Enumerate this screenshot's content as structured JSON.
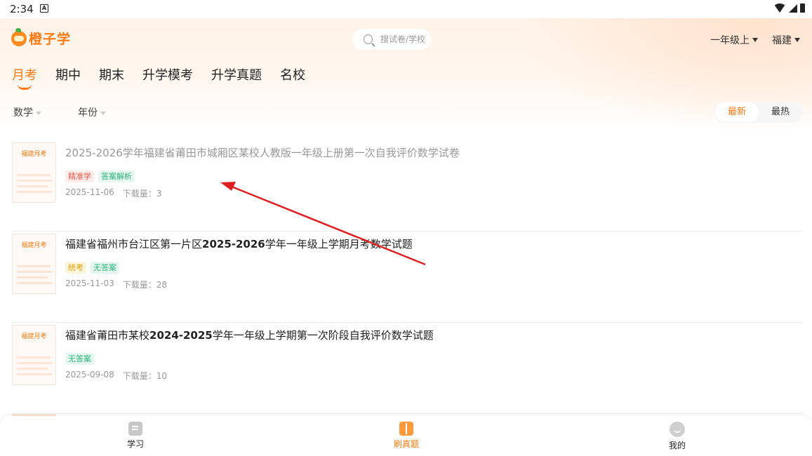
{
  "status_bar": {
    "time": "2:34",
    "notification": "A"
  },
  "header": {
    "logo_text": "橙子学",
    "search_placeholder": "搜试卷/学校",
    "grade": "一年级上",
    "region": "福建"
  },
  "tabs": [
    {
      "label": "月考",
      "active": true
    },
    {
      "label": "期中",
      "active": false
    },
    {
      "label": "期末",
      "active": false
    },
    {
      "label": "升学模考",
      "active": false
    },
    {
      "label": "升学真题",
      "active": false
    },
    {
      "label": "名校",
      "active": false
    }
  ],
  "filters": {
    "subject": "数学",
    "year": "年份"
  },
  "sort": {
    "latest": "最新",
    "hottest": "最热",
    "selected": "最新"
  },
  "papers": [
    {
      "thumb_label": "福建月考",
      "title": "2025-2026学年福建省莆田市城厢区某校人教版一年级上册第一次自我评价数学试卷",
      "visited": true,
      "tags": [
        "精准学",
        "答案解析"
      ],
      "date": "2025-11-06",
      "downloads": "下载量：3"
    },
    {
      "thumb_label": "福建月考",
      "title_prefix": "福建省福州市台江区第一片区",
      "title_bold": "2025-2026",
      "title_suffix": "学年一年级上学期月考数学试题",
      "visited": false,
      "tags": [
        "统考",
        "无答案"
      ],
      "date": "2025-11-03",
      "downloads": "下载量：28"
    },
    {
      "thumb_label": "福建月考",
      "title_prefix": "福建省莆田市某校",
      "title_bold": "2024-2025",
      "title_suffix": "学年一年级上学期第一次阶段自我评价数学试题",
      "visited": false,
      "tags": [
        "无答案"
      ],
      "date": "2025-09-08",
      "downloads": "下载量：10"
    }
  ],
  "bottom_nav": [
    {
      "label": "学习",
      "icon": "study-icon",
      "active": false
    },
    {
      "label": "刷真题",
      "icon": "book-icon",
      "active": true
    },
    {
      "label": "我的",
      "icon": "profile-icon",
      "active": false
    }
  ],
  "colors": {
    "accent": "#ff7a12",
    "annotation_arrow": "#e02020",
    "tag_red": "#ef5a4a",
    "tag_green": "#2bb57a",
    "tag_yellow": "#e5a100"
  }
}
